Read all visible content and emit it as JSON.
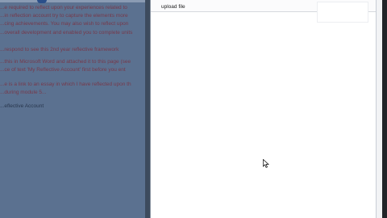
{
  "background_page": {
    "lines": [
      {
        "text": "...e required to reflect upon your experiences related to",
        "style": "link"
      },
      {
        "text": "...in reflection account try to capture the elements more",
        "style": "link"
      },
      {
        "text": "...cing achievements. You may also wish to reflect upon",
        "style": "link"
      },
      {
        "text": "...overall development and enabled you to complete units",
        "style": "link"
      },
      {
        "text": "...respond to see this 2nd year reflective framework",
        "style": "link"
      },
      {
        "text": "...this in Microsoft Word and attached it to this page (see",
        "style": "link"
      },
      {
        "text": "...ce of text 'My Reflective Account' first before you ent",
        "style": "link"
      },
      {
        "text": "...e is a link to an essay in which I have reflected upon th",
        "style": "link"
      },
      {
        "text": "...during module 5...",
        "style": "link"
      },
      {
        "text": "...eflective Account",
        "style": "plain"
      }
    ]
  },
  "dialog": {
    "title": "upload file"
  },
  "icons": {
    "cursor": "mouse-pointer-icon"
  }
}
